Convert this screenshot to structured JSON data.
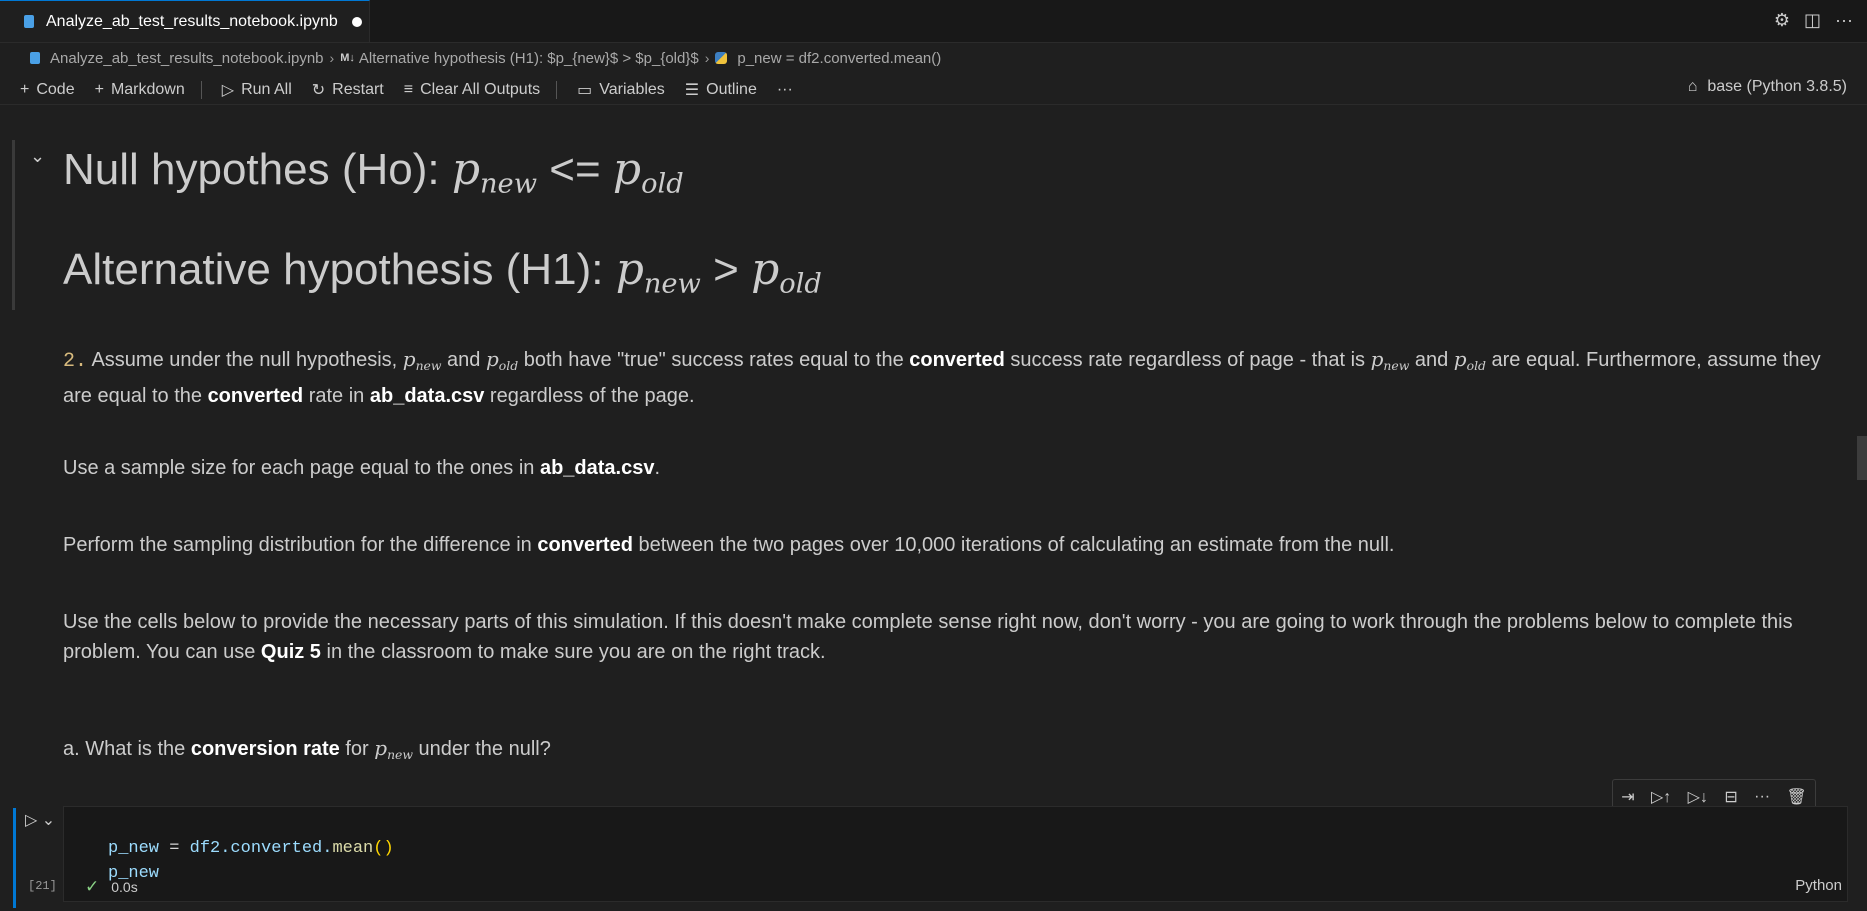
{
  "tab": {
    "title": "Analyze_ab_test_results_notebook.ipynb"
  },
  "breadcrumb": {
    "file": "Analyze_ab_test_results_notebook.ipynb",
    "md_badge": "M↓",
    "section": "Alternative hypothesis (H1): $p_{new}$ > $p_{old}$",
    "cell": "p_new = df2.converted.mean()"
  },
  "toolbar": {
    "code": "Code",
    "markdown": "Markdown",
    "run_all": "Run All",
    "restart": "Restart",
    "clear_outputs": "Clear All Outputs",
    "variables": "Variables",
    "outline": "Outline",
    "more": "···"
  },
  "kernel": {
    "label": "base (Python 3.8.5)"
  },
  "headings": {
    "null_text": "Null hypothes (Ho): ",
    "null_op": " <= ",
    "alt_text": "Alternative hypothesis (H1): ",
    "alt_op": " > ",
    "p": "p",
    "new": "new",
    "old": "old"
  },
  "paragraphs": {
    "p1_num": "2.",
    "p1_a": " Assume under the null hypothesis, ",
    "p1_and1": " and ",
    "p1_b": " both have \"true\" success rates equal to the ",
    "converted": "converted",
    "p1_c": " success rate regardless of page - that is ",
    "p1_and2": " and ",
    "p1_d": " are equal. Furthermore, assume they are equal to the ",
    "p1_e": " rate in ",
    "csv": "ab_data.csv",
    "p1_f": " regardless of the page.",
    "p2_a": "Use a sample size for each page equal to the ones in ",
    "p2_b": ".",
    "p3_a": "Perform the sampling distribution for the difference in ",
    "p3_b": " between the two pages over 10,000 iterations of calculating an estimate from the null.",
    "p4_a": "Use the cells below to provide the necessary parts of this simulation. If this doesn't make complete sense right now, don't worry - you are going to work through the problems below to complete this problem. You can use ",
    "quiz": "Quiz 5",
    "p4_b": " in the classroom to make sure you are on the right track.",
    "p5_a": "a. What is the ",
    "conv_rate": "conversion rate",
    "p5_b": " for ",
    "p5_c": " under the null?"
  },
  "code_cell": {
    "var": "p_new",
    "eq": " = ",
    "obj": "df2.converted.",
    "fn": "mean",
    "paren": "()",
    "line2": "p_new",
    "exec_count": "[21]",
    "duration": "0.0s",
    "language": "Python"
  }
}
